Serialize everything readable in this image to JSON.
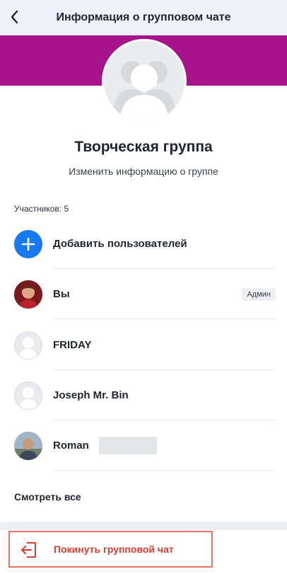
{
  "header": {
    "title": "Информация о групповом чате",
    "back_icon": "chevron-left-icon"
  },
  "group": {
    "name": "Творческая группа",
    "edit_label": "Изменить информацию о группе",
    "banner_color": "#a8128c"
  },
  "members": {
    "count_label": "Участников: 5",
    "add_label": "Добавить пользователей",
    "items": [
      {
        "name": "Вы",
        "badge": "Админ",
        "avatar": "photo"
      },
      {
        "name": "FRIDAY",
        "avatar": "placeholder"
      },
      {
        "name": "Joseph Mr. Bin",
        "avatar": "placeholder"
      },
      {
        "name": "Roman",
        "avatar": "photo"
      }
    ],
    "see_all_label": "Смотреть все"
  },
  "leave": {
    "label": "Покинуть групповой чат",
    "icon": "leave-icon",
    "accent": "#e03b2f"
  }
}
